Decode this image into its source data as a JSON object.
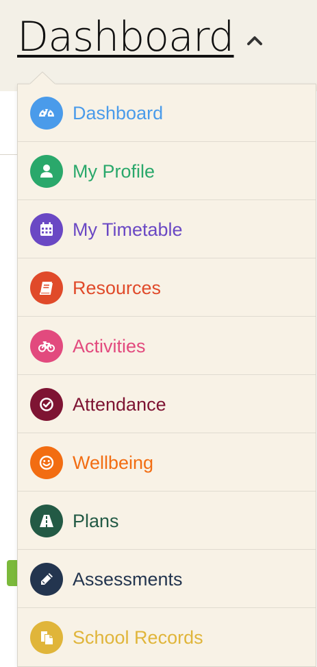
{
  "header": {
    "title": "Dashboard",
    "caret_icon": "chevron-up-icon"
  },
  "menu": {
    "items": [
      {
        "label": "Dashboard",
        "color": "#4a9bea",
        "icon": "dashboard-gauge-icon"
      },
      {
        "label": "My Profile",
        "color": "#2aa86b",
        "icon": "user-icon"
      },
      {
        "label": "My Timetable",
        "color": "#6a48c4",
        "icon": "calendar-icon"
      },
      {
        "label": "Resources",
        "color": "#e04a2a",
        "icon": "book-icon"
      },
      {
        "label": "Activities",
        "color": "#e24a7e",
        "icon": "bicycle-icon"
      },
      {
        "label": "Attendance",
        "color": "#7e1433",
        "icon": "check-circle-icon"
      },
      {
        "label": "Wellbeing",
        "color": "#f26d12",
        "icon": "smile-icon"
      },
      {
        "label": "Plans",
        "color": "#235a45",
        "icon": "road-icon"
      },
      {
        "label": "Assessments",
        "color": "#23354f",
        "icon": "pencil-icon"
      },
      {
        "label": "School Records",
        "color": "#e0b53a",
        "icon": "copy-document-icon"
      }
    ]
  }
}
